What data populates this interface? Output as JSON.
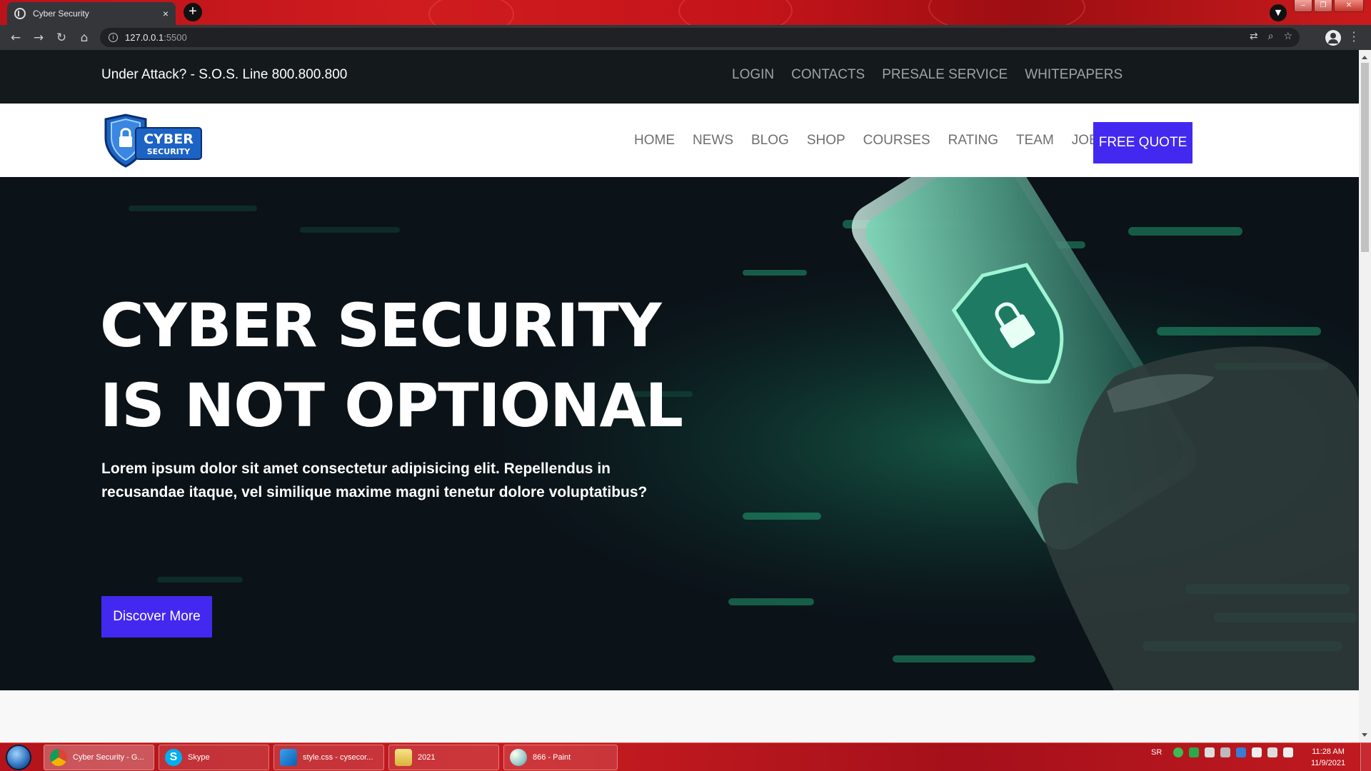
{
  "browser": {
    "tab_title": "Cyber Security",
    "tab_close": "×",
    "new_tab": "+",
    "url_host": "127.0.0.1",
    "url_port": ":5500",
    "url_info": "i",
    "window_controls": [
      "–",
      "❐",
      "✕"
    ]
  },
  "topbar": {
    "sos_text": "Under Attack? - S.O.S. Line 800.800.800",
    "links": [
      "LOGIN",
      "CONTACTS",
      "PRESALE SERVICE",
      "WHITEPAPERS"
    ]
  },
  "navbar": {
    "logo_text_top": "CYBER",
    "logo_text_bottom": "SECURITY",
    "links": [
      "HOME",
      "NEWS",
      "BLOG",
      "SHOP",
      "COURSES",
      "RATING",
      "TEAM",
      "JOB"
    ],
    "cta_label": "FREE QUOTE"
  },
  "hero": {
    "title_line1": "CYBER SECURITY",
    "title_line2": "IS NOT OPTIONAL",
    "text": "Lorem ipsum dolor sit amet consectetur adipisicing elit. Repellendus in recusandae itaque, vel similique maxime magni tenetur dolore voluptatibus?",
    "button_label": "Discover More"
  },
  "taskbar": {
    "items": [
      {
        "label": "Cyber Security - G...",
        "icon": "chrome-icon",
        "active": true
      },
      {
        "label": "Skype",
        "icon": "skype-icon",
        "active": false
      },
      {
        "label": "style.css - cysecor...",
        "icon": "vscode-icon",
        "active": false
      },
      {
        "label": "2021",
        "icon": "folder-icon",
        "active": false
      },
      {
        "label": "866 - Paint",
        "icon": "paint-icon",
        "active": false
      }
    ],
    "tray_lang": "SR",
    "clock_time": "11:28 AM",
    "clock_date": "11/9/2021"
  },
  "colors": {
    "accent": "#4329f0",
    "topbar_bg": "#141a1c",
    "hero_bg": "#0b1218",
    "hero_glow": "#2ee6a0"
  }
}
